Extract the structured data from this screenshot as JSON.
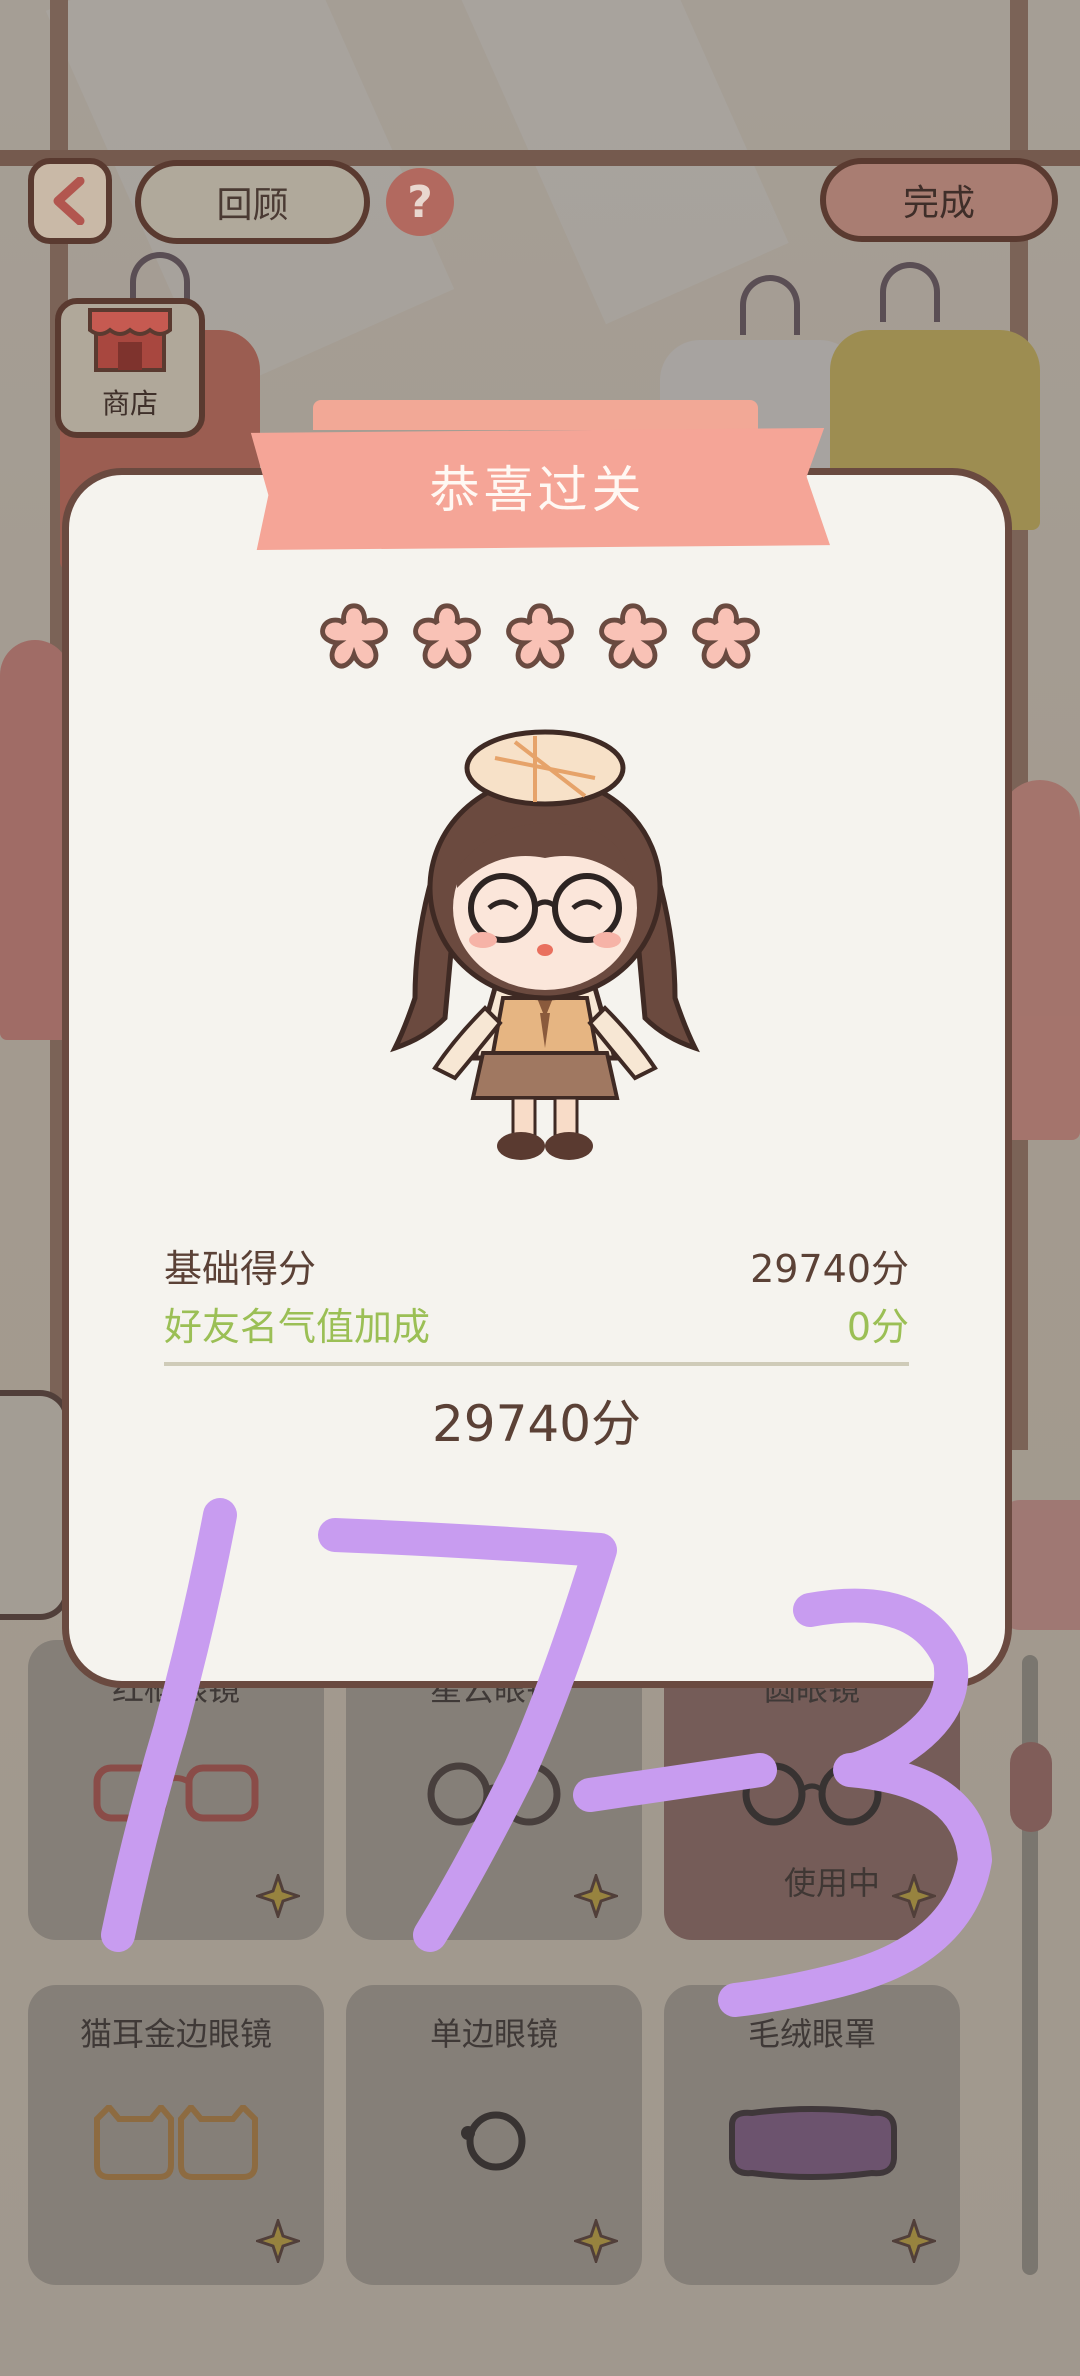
{
  "top_bar": {
    "back_icon": "chevron-left-icon",
    "review_label": "回顾",
    "help_icon": "question-icon",
    "done_label": "完成",
    "shop_label": "商店"
  },
  "result_modal": {
    "title": "恭喜过关",
    "stars_filled": 5,
    "stars_total": 5,
    "base_score_label": "基础得分",
    "base_score_value": "29740分",
    "bonus_label": "好友名气值加成",
    "bonus_value": "0分",
    "total_score": "29740分"
  },
  "items": [
    {
      "label": "红框眼镜",
      "status": ""
    },
    {
      "label": "星云眼镜",
      "status": ""
    },
    {
      "label": "圆眼镜",
      "status": "使用中"
    },
    {
      "label": "猫耳金边眼镜",
      "status": ""
    },
    {
      "label": "单边眼镜",
      "status": ""
    },
    {
      "label": "毛绒眼罩",
      "status": ""
    }
  ],
  "handwriting": "17-3",
  "colors": {
    "ribbon": "#f5a597",
    "star_fill": "#f9c2b6",
    "star_outline": "#6a4a40",
    "bonus_text": "#9bbf55",
    "handwriting": "#c89cf0",
    "modal_bg": "#f5f3ee"
  }
}
